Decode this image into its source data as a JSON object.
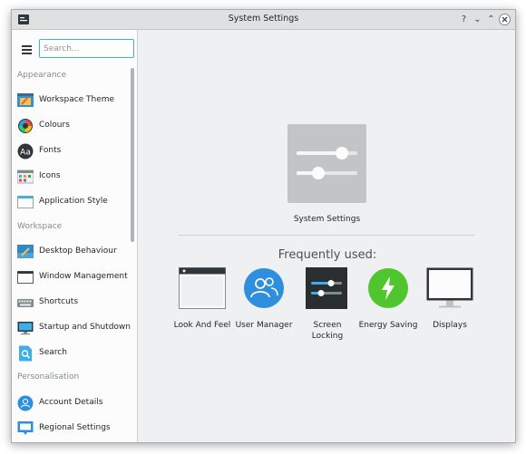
{
  "window": {
    "title": "System Settings"
  },
  "titlebar": {
    "help": "?",
    "minimize": "⌄",
    "maximize": "⌃",
    "close": "×"
  },
  "search": {
    "placeholder": "Search..."
  },
  "sidebar": {
    "sections": [
      "Appearance",
      "Workspace",
      "Personalisation"
    ],
    "appearance_items": [
      {
        "label": "Workspace Theme",
        "icon": "workspace-theme-icon"
      },
      {
        "label": "Colours",
        "icon": "colours-icon"
      },
      {
        "label": "Fonts",
        "icon": "fonts-icon"
      },
      {
        "label": "Icons",
        "icon": "icons-icon"
      },
      {
        "label": "Application Style",
        "icon": "application-style-icon"
      }
    ],
    "workspace_items": [
      {
        "label": "Desktop Behaviour",
        "icon": "desktop-behaviour-icon"
      },
      {
        "label": "Window Management",
        "icon": "window-management-icon"
      },
      {
        "label": "Shortcuts",
        "icon": "keyboard-icon"
      },
      {
        "label": "Startup and Shutdown",
        "icon": "monitor-icon"
      },
      {
        "label": "Search",
        "icon": "search-icon"
      }
    ],
    "personalisation_items": [
      {
        "label": "Account Details",
        "icon": "user-icon"
      },
      {
        "label": "Regional Settings",
        "icon": "regional-icon"
      }
    ]
  },
  "main": {
    "title": "System Settings",
    "frequently_used_title": "Frequently used:",
    "frequent": [
      {
        "label": "Look And Feel",
        "icon": "look-and-feel-icon"
      },
      {
        "label": "User Manager",
        "icon": "user-manager-icon"
      },
      {
        "label": "Screen Locking",
        "icon": "screen-locking-icon"
      },
      {
        "label": "Energy Saving",
        "icon": "energy-saving-icon"
      },
      {
        "label": "Displays",
        "icon": "displays-icon"
      }
    ]
  },
  "colors": {
    "accent": "#3daee9",
    "green": "#4fc52e",
    "blue": "#2d8fde"
  }
}
